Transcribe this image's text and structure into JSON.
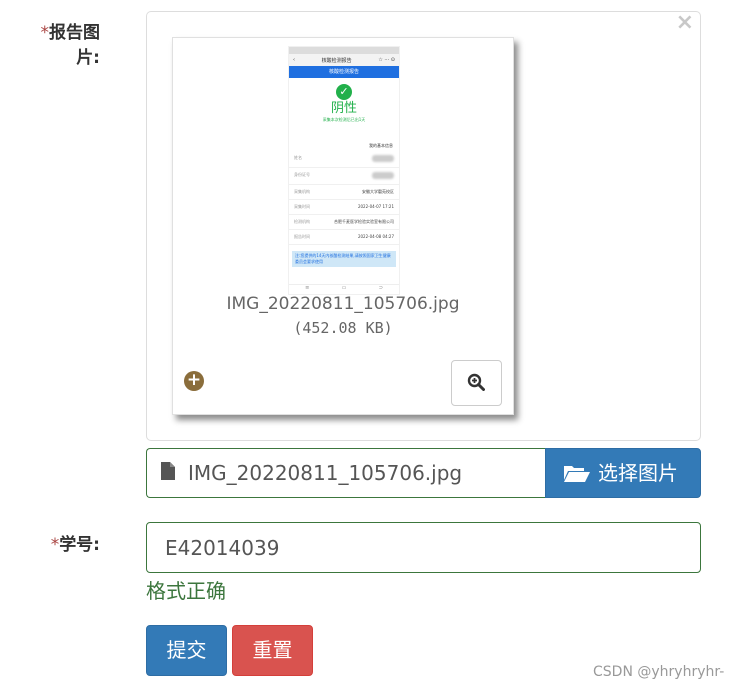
{
  "form": {
    "report_label": "报告图片:",
    "required_mark": "*",
    "student_label": "学号:",
    "close_glyph": "×"
  },
  "preview": {
    "file_name": "IMG_20220811_105706.jpg",
    "file_size": "(452.08 KB)",
    "add_icon": "plus-circle-icon",
    "zoom_icon": "zoom-in-icon",
    "phone": {
      "title": "核酸检测报告",
      "header": "核酸检测报告",
      "result": "阴性",
      "sub": "采集本次检测后已出1天",
      "section": "我的基本信息",
      "rows": [
        {
          "k": "姓名",
          "v": ""
        },
        {
          "k": "身份证号",
          "v": ""
        },
        {
          "k": "采集机构",
          "v": "安徽大学磬苑校区"
        },
        {
          "k": "采集时间",
          "v": "2022-04-07 17:21"
        },
        {
          "k": "检测机构",
          "v": "合肥千麦医学检验实验室有限公司"
        },
        {
          "k": "报告时间",
          "v": "2022-04-08 04:27"
        }
      ],
      "note": "注:您提供的14天内核酸检测结果,请按照国家卫生健康委员会要求使用"
    }
  },
  "file_input": {
    "caption": "IMG_20220811_105706.jpg",
    "browse_label": "选择图片",
    "doc_icon": "file-icon",
    "folder_icon": "folder-open-icon"
  },
  "student": {
    "value": "E42014039",
    "help": "格式正确"
  },
  "buttons": {
    "submit": "提交",
    "reset": "重置"
  },
  "watermark": "CSDN @yhryhryhr-",
  "colors": {
    "primary": "#337ab7",
    "danger": "#d9534f",
    "success": "#3c763d",
    "required": "#a94442"
  }
}
